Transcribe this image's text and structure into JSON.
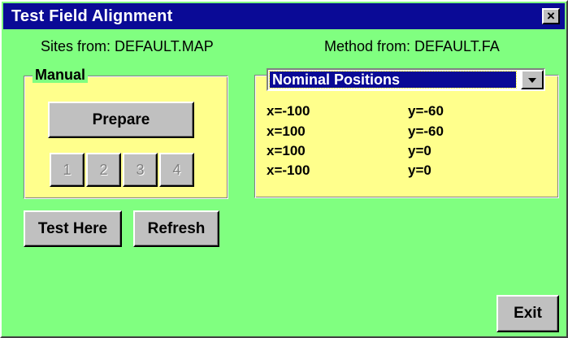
{
  "window": {
    "title": "Test Field Alignment",
    "close_label": "×"
  },
  "info": {
    "sites": "Sites from: DEFAULT.MAP",
    "method": "Method from: DEFAULT.FA"
  },
  "manual": {
    "legend": "Manual",
    "prepare_label": "Prepare",
    "step_buttons": [
      "1",
      "2",
      "3",
      "4"
    ]
  },
  "positions": {
    "selected": "Nominal Positions",
    "rows": [
      {
        "x": "x=-100",
        "y": "y=-60"
      },
      {
        "x": "x=100",
        "y": "y=-60"
      },
      {
        "x": "x=100",
        "y": "y=0"
      },
      {
        "x": "x=-100",
        "y": "y=0"
      }
    ]
  },
  "actions": {
    "test_here": "Test Here",
    "refresh": "Refresh",
    "exit": "Exit"
  },
  "colors": {
    "background": "#80ff80",
    "panel": "#ffff8c",
    "title_bar": "#0a0a96",
    "button_face": "#c0c0c0"
  }
}
